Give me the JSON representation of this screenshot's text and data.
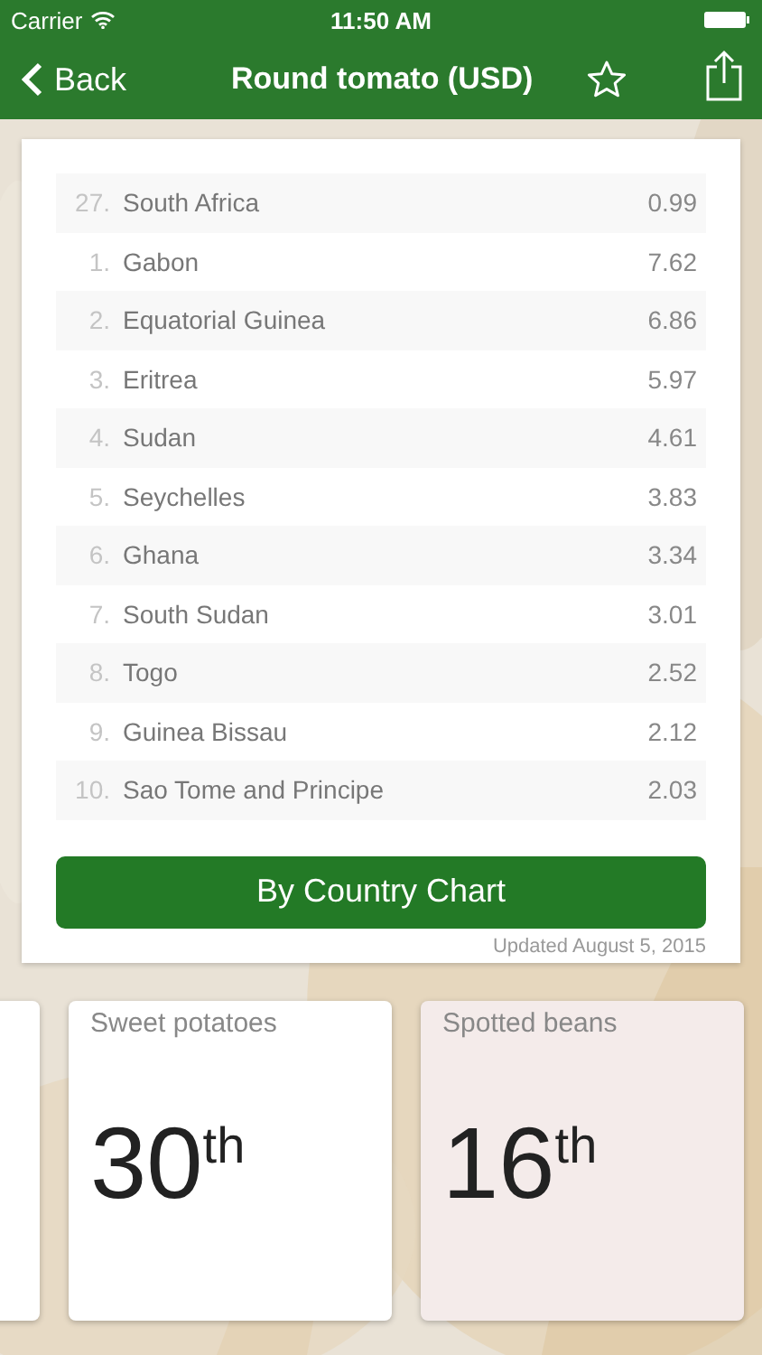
{
  "status_bar": {
    "carrier": "Carrier",
    "time": "11:50 AM"
  },
  "nav": {
    "back": "Back",
    "title": "Round tomato (USD)"
  },
  "ranking": [
    {
      "rank": "27.",
      "country": "South Africa",
      "value": "0.99"
    },
    {
      "rank": "1.",
      "country": "Gabon",
      "value": "7.62"
    },
    {
      "rank": "2.",
      "country": "Equatorial Guinea",
      "value": "6.86"
    },
    {
      "rank": "3.",
      "country": "Eritrea",
      "value": "5.97"
    },
    {
      "rank": "4.",
      "country": "Sudan",
      "value": "4.61"
    },
    {
      "rank": "5.",
      "country": "Seychelles",
      "value": "3.83"
    },
    {
      "rank": "6.",
      "country": "Ghana",
      "value": "3.34"
    },
    {
      "rank": "7.",
      "country": "South Sudan",
      "value": "3.01"
    },
    {
      "rank": "8.",
      "country": "Togo",
      "value": "2.52"
    },
    {
      "rank": "9.",
      "country": "Guinea Bissau",
      "value": "2.12"
    },
    {
      "rank": "10.",
      "country": "Sao Tome and Principe",
      "value": "2.03"
    }
  ],
  "chart_button": "By Country Chart",
  "updated": "Updated August 5, 2015",
  "cards": [
    {
      "title": "Sweet potatoes",
      "rank": "30",
      "suffix": "th",
      "selected": false
    },
    {
      "title": "Spotted beans",
      "rank": "16",
      "suffix": "th",
      "selected": true
    }
  ]
}
